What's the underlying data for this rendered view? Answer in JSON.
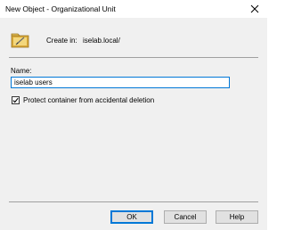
{
  "window": {
    "title": "New Object - Organizational Unit",
    "close_icon": "close-icon"
  },
  "header": {
    "icon": "organizational-unit-icon",
    "create_in_label": "Create in:",
    "create_in_path": "iselab.local/"
  },
  "form": {
    "name_label": "Name:",
    "name_value": "iselab users",
    "protect_label": "Protect container from accidental deletion",
    "protect_checked": true
  },
  "buttons": {
    "ok": "OK",
    "cancel": "Cancel",
    "help": "Help"
  },
  "colors": {
    "focus_accent": "#0078d7",
    "dialog_background": "#f0f0f0"
  }
}
